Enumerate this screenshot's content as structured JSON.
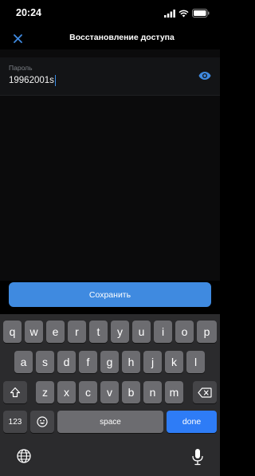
{
  "status_bar": {
    "time": "20:24"
  },
  "header": {
    "title": "Восстановление доступа"
  },
  "field": {
    "label": "Пароль",
    "value": "19962001s"
  },
  "save_button": {
    "label": "Сохранить"
  },
  "keyboard": {
    "row1": [
      "q",
      "w",
      "e",
      "r",
      "t",
      "y",
      "u",
      "i",
      "o",
      "p"
    ],
    "row2": [
      "a",
      "s",
      "d",
      "f",
      "g",
      "h",
      "j",
      "k",
      "l"
    ],
    "row3": [
      "z",
      "x",
      "c",
      "v",
      "b",
      "n",
      "m"
    ],
    "numbers_label": "123",
    "space_label": "space",
    "done_label": "done"
  },
  "colors": {
    "accent": "#3f8ae0",
    "done": "#2e7cf6",
    "key": "#6c6c70",
    "key_dark": "#454548"
  }
}
